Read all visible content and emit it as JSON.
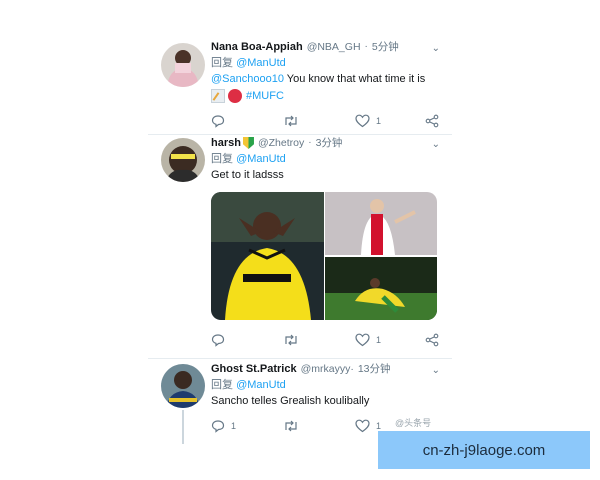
{
  "tweets": [
    {
      "name": "Nana Boa-Appiah",
      "handle": "@NBA_GH",
      "time": "5分钟",
      "reply_prefix": "回复",
      "reply_to": "@ManUtd",
      "mention": "@Sanchooo10",
      "text": " You know that what time it is",
      "hashtag": "#MUFC",
      "likes": "1"
    },
    {
      "name": "harsh",
      "handle": "@Zhetroy",
      "time": "3分钟",
      "reply_prefix": "回复",
      "reply_to": "@ManUtd",
      "text": "Get to it ladsss",
      "likes": "1"
    },
    {
      "name": "Ghost St.Patrick",
      "handle": "@mrkayyy·",
      "time": "13分钟",
      "reply_prefix": "回复",
      "reply_to": "@ManUtd",
      "text": "Sancho telles Grealish koulibally",
      "replies": "1",
      "likes": "1"
    }
  ],
  "watermark": "@头条号",
  "banner_text": "cn-zh-j9laoge.com",
  "colors": {
    "accent": "#1da1f2",
    "muted": "#657786",
    "banner": "#8cc8fa"
  }
}
